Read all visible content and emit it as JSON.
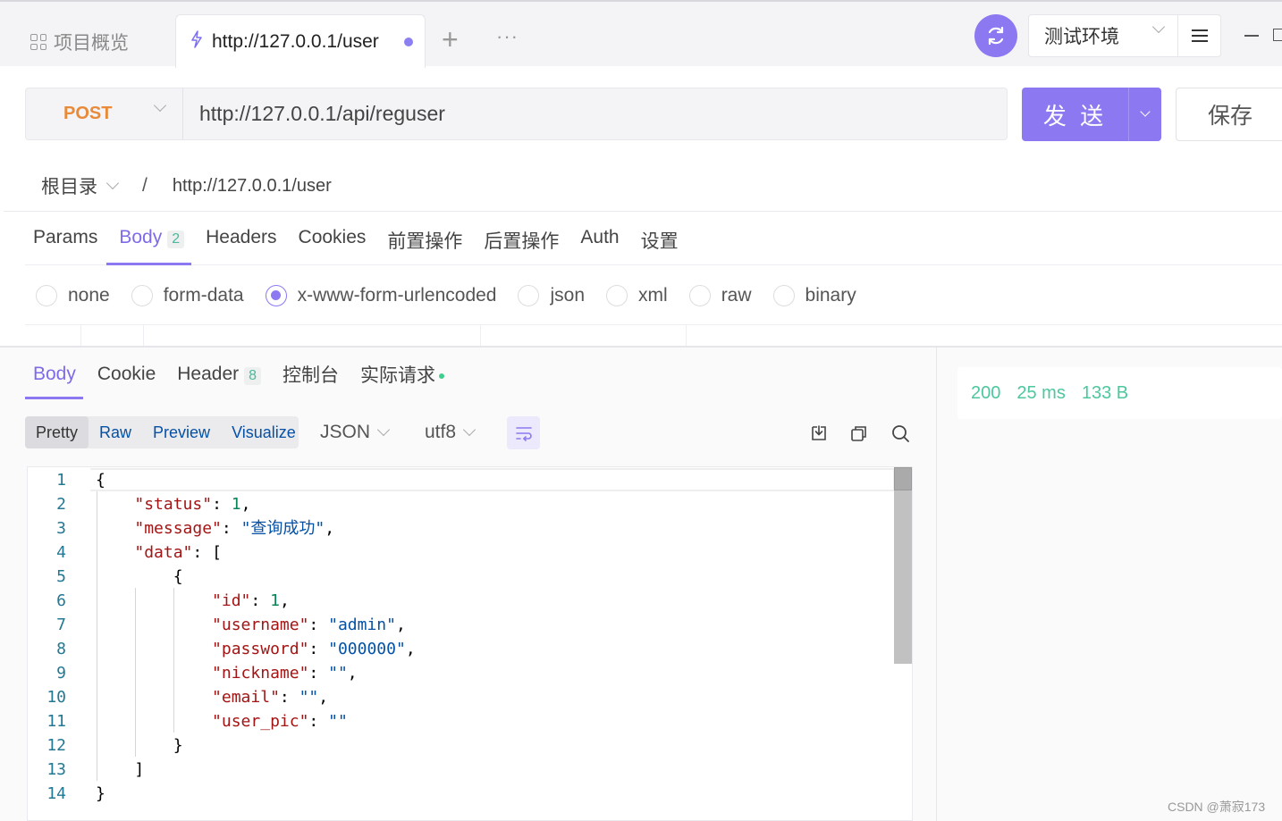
{
  "top_tabs": {
    "overview_label": "项目概览",
    "active_tab_label": "http://127.0.0.1/user",
    "add_symbol": "+",
    "more_symbol": "···"
  },
  "env": {
    "label": "测试环境"
  },
  "request": {
    "method": "POST",
    "url": "http://127.0.0.1/api/reguser",
    "send_label": "发 送",
    "save_label": "保存"
  },
  "breadcrumb": {
    "root": "根目录",
    "sep": "/",
    "current": "http://127.0.0.1/user"
  },
  "request_tabs": [
    {
      "label": "Params",
      "badge": ""
    },
    {
      "label": "Body",
      "badge": "2"
    },
    {
      "label": "Headers",
      "badge": ""
    },
    {
      "label": "Cookies",
      "badge": ""
    },
    {
      "label": "前置操作",
      "badge": ""
    },
    {
      "label": "后置操作",
      "badge": ""
    },
    {
      "label": "Auth",
      "badge": ""
    },
    {
      "label": "设置",
      "badge": ""
    }
  ],
  "body_types": [
    "none",
    "form-data",
    "x-www-form-urlencoded",
    "json",
    "xml",
    "raw",
    "binary"
  ],
  "body_type_selected": "x-www-form-urlencoded",
  "response_tabs": [
    {
      "label": "Body",
      "badge": ""
    },
    {
      "label": "Cookie",
      "badge": ""
    },
    {
      "label": "Header",
      "badge": "8"
    },
    {
      "label": "控制台",
      "badge": ""
    },
    {
      "label": "实际请求",
      "badge": ""
    }
  ],
  "view_modes": [
    "Pretty",
    "Raw",
    "Preview",
    "Visualize"
  ],
  "view_mode_selected": "Pretty",
  "format": "JSON",
  "encoding": "utf8",
  "status": {
    "code": "200",
    "time": "25 ms",
    "size": "133 B"
  },
  "code_lines": [
    "{",
    "    \"status\": 1,",
    "    \"message\": \"查询成功\",",
    "    \"data\": [",
    "        {",
    "            \"id\": 1,",
    "            \"username\": \"admin\",",
    "            \"password\": \"000000\",",
    "            \"nickname\": \"\",",
    "            \"email\": \"\",",
    "            \"user_pic\": \"\"",
    "        }",
    "    ]",
    "}"
  ],
  "watermark": "CSDN @萧寂173",
  "colors": {
    "accent": "#8c78f0",
    "method": "#e88a3a",
    "status": "#4cc79e"
  }
}
